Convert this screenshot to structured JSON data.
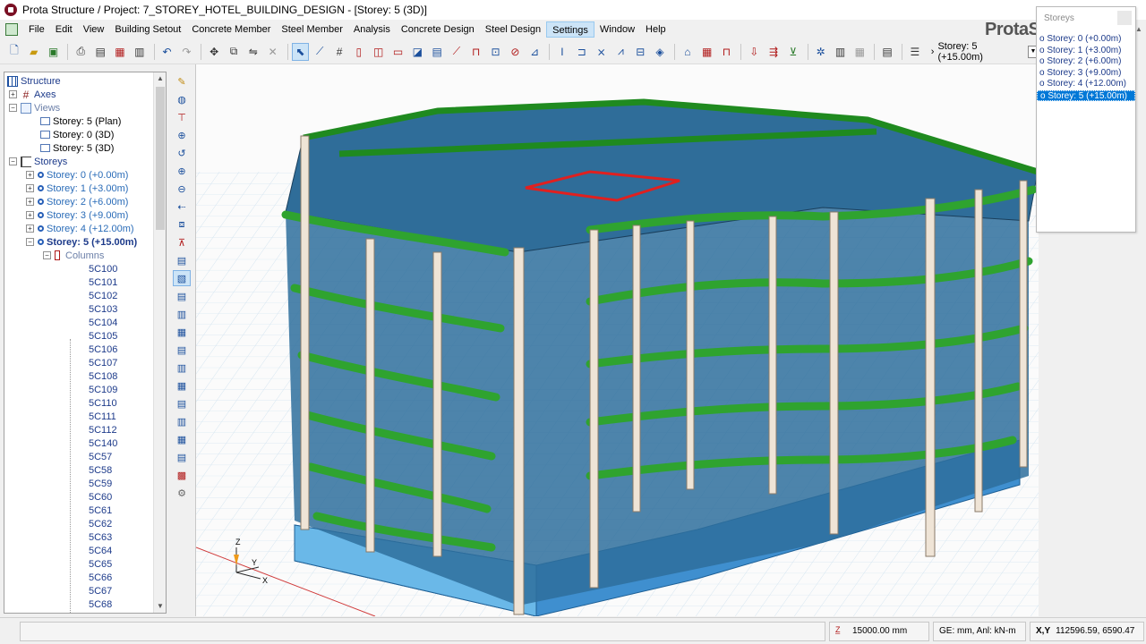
{
  "window": {
    "title": "Prota Structure / Project: 7_STOREY_HOTEL_BUILDING_DESIGN - [Storey: 5 (3D)]"
  },
  "menu": {
    "items": [
      "File",
      "Edit",
      "View",
      "Building Setout",
      "Concrete Member",
      "Steel Member",
      "Analysis",
      "Concrete Design",
      "Steel Design",
      "Settings",
      "Window",
      "Help"
    ],
    "hovered": "Settings"
  },
  "toolbar": {
    "storey_selector": "Storey: 5 (+15.00m)"
  },
  "brand": {
    "text": "ProtaS"
  },
  "tree": {
    "root": "Structure",
    "axes": "Axes",
    "views": "Views",
    "view_items": [
      "Storey: 5 (Plan)",
      "Storey: 0 (3D)",
      "Storey: 5 (3D)"
    ],
    "storeys": "Storeys",
    "storey_items": [
      "Storey: 0 (+0.00m)",
      "Storey: 1 (+3.00m)",
      "Storey: 2 (+6.00m)",
      "Storey: 3 (+9.00m)",
      "Storey: 4 (+12.00m)",
      "Storey: 5 (+15.00m)"
    ],
    "columns": "Columns",
    "column_items": [
      "5C100",
      "5C101",
      "5C102",
      "5C103",
      "5C104",
      "5C105",
      "5C106",
      "5C107",
      "5C108",
      "5C109",
      "5C110",
      "5C111",
      "5C112",
      "5C140",
      "5C57",
      "5C58",
      "5C59",
      "5C60",
      "5C61",
      "5C62",
      "5C63",
      "5C64",
      "5C65",
      "5C66",
      "5C67",
      "5C68"
    ]
  },
  "storey_popup": {
    "title": "Storeys",
    "items": [
      "o Storey: 0 (+0.00m)",
      "o Storey: 1 (+3.00m)",
      "o Storey: 2 (+6.00m)",
      "o Storey: 3 (+9.00m)",
      "o Storey: 4 (+12.00m)",
      "o Storey: 5 (+15.00m)"
    ],
    "selected_index": 5
  },
  "viewport": {
    "axis_labels": {
      "z": "Z",
      "y": "Y",
      "x": "X"
    }
  },
  "status": {
    "elevation": "15000.00 mm",
    "units": "GE: mm,  Anl: kN-m",
    "coords_label": "X,Y",
    "coords": "112596.59, 6590.47"
  }
}
